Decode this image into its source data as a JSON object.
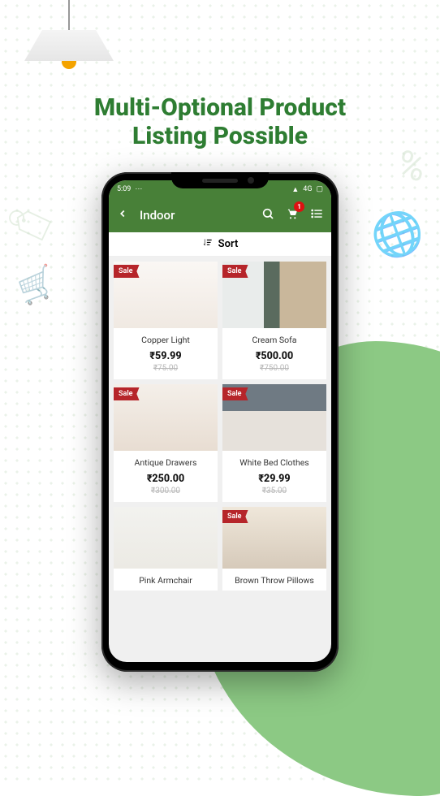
{
  "promo_headline_line1": "Multi-Optional Product",
  "promo_headline_line2": "Listing Possible",
  "statusbar": {
    "time": "5:09",
    "icons_left": "⋯",
    "network": "4G",
    "signal": "▲",
    "battery": "▢"
  },
  "appbar": {
    "title": "Indoor",
    "cart_badge": "1"
  },
  "sort_label": "Sort",
  "products": [
    {
      "name": "Copper Light",
      "price": "₹59.99",
      "old": "₹75.00",
      "sale": "Sale",
      "thumb": "th1"
    },
    {
      "name": "Cream Sofa",
      "price": "₹500.00",
      "old": "₹750.00",
      "sale": "Sale",
      "thumb": "th2"
    },
    {
      "name": "Antique Drawers",
      "price": "₹250.00",
      "old": "₹300.00",
      "sale": "Sale",
      "thumb": "th3"
    },
    {
      "name": "White Bed Clothes",
      "price": "₹29.99",
      "old": "₹35.00",
      "sale": "Sale",
      "thumb": "th4"
    },
    {
      "name": "Pink Armchair",
      "price": "",
      "old": "",
      "sale": "",
      "thumb": "th5"
    },
    {
      "name": "Brown Throw Pillows",
      "price": "",
      "old": "",
      "sale": "Sale",
      "thumb": "th6"
    }
  ]
}
